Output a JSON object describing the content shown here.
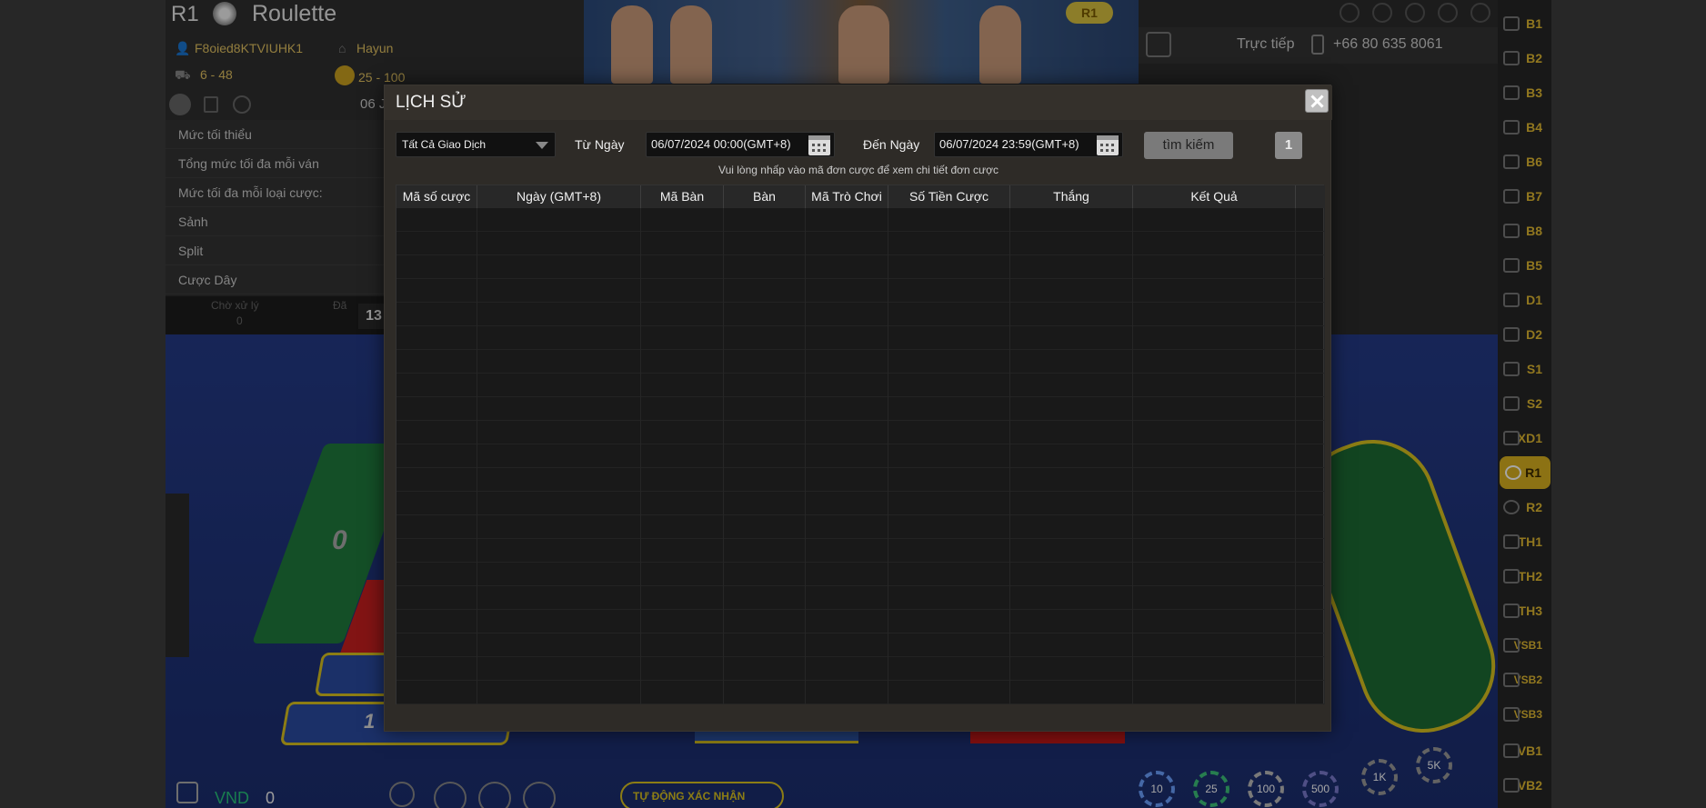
{
  "game": {
    "table_code": "R1",
    "table_name": "Roulette",
    "username": "F8oied8KTVIUHK1",
    "dealer": "Hayun",
    "bet_range": "6 - 48",
    "limit_range": "25 - 100",
    "date_partial": "06 J",
    "limits_list": [
      "Mức tối thiểu",
      "Tổng mức tối đa mỗi ván",
      "Mức tối đa mỗi loại cược:",
      "Sảnh",
      "Split",
      "Cược Dây"
    ],
    "stats_left": "Chờ xử lý",
    "stats_left_val": "0",
    "stats_right": "Đã",
    "round_badge": "13",
    "video_badge": "R1",
    "live_label": "Trực tiếp",
    "phone": "+66 80 635 8061",
    "zero_label": "0",
    "one_label": "1",
    "currency": "VND",
    "balance": "0",
    "auto_confirm": "TỰ ĐỘNG XÁC NHẬN",
    "chips": [
      "10",
      "25",
      "100",
      "500",
      "1K",
      "5K"
    ]
  },
  "sidebar": {
    "items": [
      "B1",
      "B2",
      "B3",
      "B4",
      "B6",
      "B7",
      "B8",
      "B5",
      "D1",
      "D2",
      "S1",
      "S2",
      "XD1",
      "R1",
      "R2",
      "TH1",
      "TH2",
      "TH3",
      "VSB1",
      "VSB2",
      "VSB3",
      "VB1",
      "VB2"
    ],
    "active": "R1"
  },
  "modal": {
    "title": "LỊCH SỬ",
    "filter_value": "Tất Cả Giao Dịch",
    "from_label": "Từ Ngày",
    "from_value": "06/07/2024 00:00(GMT+8)",
    "to_label": "Đến Ngày",
    "to_value": "06/07/2024 23:59(GMT+8)",
    "search_label": "tìm kiếm",
    "page": "1",
    "hint": "Vui lòng nhấp vào mã đơn cược để xem chi tiết đơn cược",
    "columns": [
      "Mã số cược",
      "Ngày (GMT+8)",
      "Mã Bàn",
      "Bàn",
      "Mã Trò Chơi",
      "Số Tiền Cược",
      "Thắng",
      "Kết Quả",
      ""
    ]
  },
  "colors": {
    "accent": "#d8b020",
    "felt": "#243a86",
    "modal_bg": "#2e2b27"
  }
}
